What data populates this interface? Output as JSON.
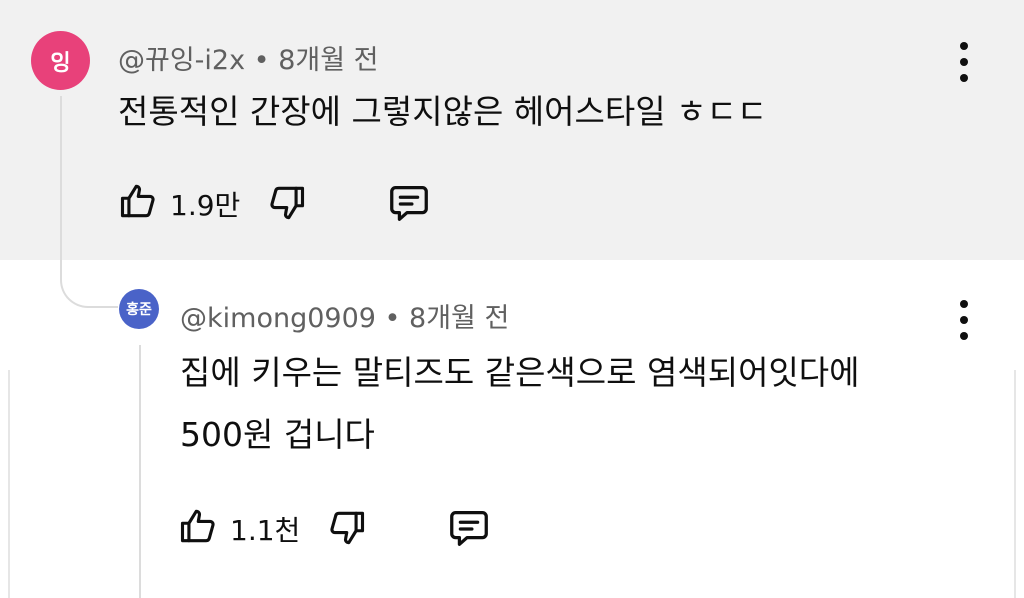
{
  "comment": {
    "avatar_text": "잉",
    "author": "@뀨잉-i2x",
    "separator": " • ",
    "time": "8개월 전",
    "text": "전통적인 간장에 그렇지않은 헤어스타일 ㅎㄷㄷ",
    "likes": "1.9만"
  },
  "reply": {
    "avatar_text": "홍준",
    "author": "@kimong0909",
    "separator": " • ",
    "time": "8개월 전",
    "text_line1": "집에 키우는 말티즈도 같은색으로 염색되어잇다에",
    "text_line2": "500원 겁니다",
    "likes": "1.1천"
  },
  "icons": {
    "like": "thumbs-up-icon",
    "dislike": "thumbs-down-icon",
    "reply": "reply-comment-icon",
    "menu": "more-vertical-icon"
  },
  "colors": {
    "highlight_bg": "#f1f1f1",
    "avatar_1": "#e8417a",
    "avatar_2": "#4a63c8",
    "meta_text": "#606060"
  }
}
